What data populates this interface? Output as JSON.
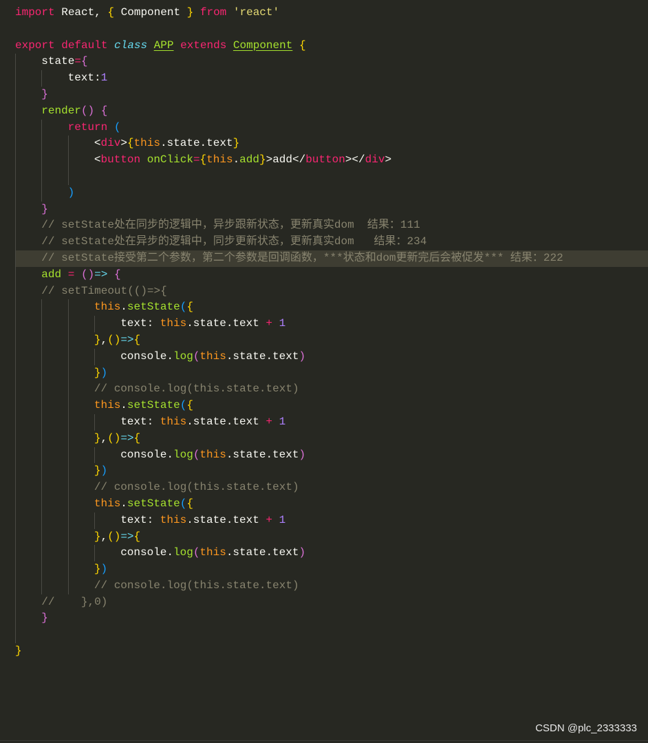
{
  "editor": {
    "highlighted_line": 15,
    "lines": [
      {
        "indent": 0,
        "tokens": [
          [
            "import",
            "kw"
          ],
          [
            " React, ",
            "tx"
          ],
          [
            "{",
            "b1"
          ],
          [
            " Component ",
            "tx"
          ],
          [
            "}",
            "b1"
          ],
          [
            " ",
            "tx"
          ],
          [
            "from",
            "kw"
          ],
          [
            " ",
            "tx"
          ],
          [
            "'react'",
            "str"
          ]
        ]
      },
      {
        "indent": 0,
        "tokens": []
      },
      {
        "indent": 0,
        "tokens": [
          [
            "export",
            "kw"
          ],
          [
            " ",
            "tx"
          ],
          [
            "default",
            "kw"
          ],
          [
            " ",
            "tx"
          ],
          [
            "class",
            "cls"
          ],
          [
            " ",
            "tx"
          ],
          [
            "APP",
            "ty"
          ],
          [
            " ",
            "tx"
          ],
          [
            "extends",
            "kw"
          ],
          [
            " ",
            "tx"
          ],
          [
            "Component",
            "ty"
          ],
          [
            " ",
            "tx"
          ],
          [
            "{",
            "b1"
          ]
        ]
      },
      {
        "indent": 1,
        "tokens": [
          [
            "state",
            "tx"
          ],
          [
            "=",
            "op"
          ],
          [
            "{",
            "b2"
          ]
        ]
      },
      {
        "indent": 2,
        "tokens": [
          [
            "text:",
            "tx"
          ],
          [
            "1",
            "num"
          ]
        ]
      },
      {
        "indent": 1,
        "tokens": [
          [
            "}",
            "b2"
          ]
        ]
      },
      {
        "indent": 1,
        "tokens": [
          [
            "render",
            "fn"
          ],
          [
            "(",
            "b2"
          ],
          [
            ")",
            "b2"
          ],
          [
            " ",
            "tx"
          ],
          [
            "{",
            "b2"
          ]
        ]
      },
      {
        "indent": 2,
        "tokens": [
          [
            "return",
            "kw"
          ],
          [
            " ",
            "tx"
          ],
          [
            "(",
            "b3"
          ]
        ]
      },
      {
        "indent": 3,
        "tokens": [
          [
            "<",
            "tx"
          ],
          [
            "div",
            "kw"
          ],
          [
            ">",
            "tx"
          ],
          [
            "{",
            "b1"
          ],
          [
            "this",
            "th"
          ],
          [
            ".state.text",
            "tx"
          ],
          [
            "}",
            "b1"
          ]
        ]
      },
      {
        "indent": 3,
        "tokens": [
          [
            "<",
            "tx"
          ],
          [
            "button",
            "kw"
          ],
          [
            " ",
            "tx"
          ],
          [
            "onClick",
            "fn"
          ],
          [
            "=",
            "op"
          ],
          [
            "{",
            "b1"
          ],
          [
            "this",
            "th"
          ],
          [
            ".",
            "tx"
          ],
          [
            "add",
            "fn"
          ],
          [
            "}",
            "b1"
          ],
          [
            ">add</",
            "tx"
          ],
          [
            "button",
            "kw"
          ],
          [
            "></",
            "tx"
          ],
          [
            "div",
            "kw"
          ],
          [
            ">",
            "tx"
          ]
        ]
      },
      {
        "indent": 3,
        "tokens": []
      },
      {
        "indent": 2,
        "tokens": [
          [
            ")",
            "b3"
          ]
        ]
      },
      {
        "indent": 1,
        "tokens": [
          [
            "}",
            "b2"
          ]
        ]
      },
      {
        "indent": 1,
        "tokens": [
          [
            "// setState处在同步的逻辑中，异步跟新状态，更新真实dom  结果：111",
            "cm"
          ]
        ]
      },
      {
        "indent": 1,
        "tokens": [
          [
            "// setState处在异步的逻辑中，同步更新状态，更新真实dom   结果：234",
            "cm"
          ]
        ]
      },
      {
        "indent": 1,
        "tokens": [
          [
            "// setState接受第二个参数，第二个参数是回调函数，***状态和dom更新完后会被促发*** 结果：222",
            "cm"
          ]
        ]
      },
      {
        "indent": 1,
        "tokens": [
          [
            "add",
            "fn"
          ],
          [
            " ",
            "tx"
          ],
          [
            "=",
            "op"
          ],
          [
            " ",
            "tx"
          ],
          [
            "(",
            "b2"
          ],
          [
            ")",
            "b2"
          ],
          [
            "=>",
            "ar"
          ],
          [
            " ",
            "tx"
          ],
          [
            "{",
            "b2"
          ]
        ]
      },
      {
        "indent": 1,
        "tokens": [
          [
            "// setTimeout(()=>{",
            "cm"
          ]
        ]
      },
      {
        "indent": 3,
        "tokens": [
          [
            "this",
            "th"
          ],
          [
            ".",
            "tx"
          ],
          [
            "setState",
            "fn"
          ],
          [
            "(",
            "b3"
          ],
          [
            "{",
            "b1"
          ]
        ]
      },
      {
        "indent": 4,
        "tokens": [
          [
            "text: ",
            "tx"
          ],
          [
            "this",
            "th"
          ],
          [
            ".state.text ",
            "tx"
          ],
          [
            "+",
            "op"
          ],
          [
            " ",
            "tx"
          ],
          [
            "1",
            "num"
          ]
        ]
      },
      {
        "indent": 3,
        "tokens": [
          [
            "}",
            "b1"
          ],
          [
            ",",
            "tx"
          ],
          [
            "(",
            "b1"
          ],
          [
            ")",
            "b1"
          ],
          [
            "=>",
            "ar"
          ],
          [
            "{",
            "b1"
          ]
        ]
      },
      {
        "indent": 4,
        "tokens": [
          [
            "console.",
            "tx"
          ],
          [
            "log",
            "fn"
          ],
          [
            "(",
            "b2"
          ],
          [
            "this",
            "th"
          ],
          [
            ".state.text",
            "tx"
          ],
          [
            ")",
            "b2"
          ]
        ]
      },
      {
        "indent": 3,
        "tokens": [
          [
            "}",
            "b1"
          ],
          [
            ")",
            "b3"
          ]
        ]
      },
      {
        "indent": 3,
        "tokens": [
          [
            "// console.log(this.state.text)",
            "cm"
          ]
        ]
      },
      {
        "indent": 3,
        "tokens": [
          [
            "this",
            "th"
          ],
          [
            ".",
            "tx"
          ],
          [
            "setState",
            "fn"
          ],
          [
            "(",
            "b3"
          ],
          [
            "{",
            "b1"
          ]
        ]
      },
      {
        "indent": 4,
        "tokens": [
          [
            "text: ",
            "tx"
          ],
          [
            "this",
            "th"
          ],
          [
            ".state.text ",
            "tx"
          ],
          [
            "+",
            "op"
          ],
          [
            " ",
            "tx"
          ],
          [
            "1",
            "num"
          ]
        ]
      },
      {
        "indent": 3,
        "tokens": [
          [
            "}",
            "b1"
          ],
          [
            ",",
            "tx"
          ],
          [
            "(",
            "b1"
          ],
          [
            ")",
            "b1"
          ],
          [
            "=>",
            "ar"
          ],
          [
            "{",
            "b1"
          ]
        ]
      },
      {
        "indent": 4,
        "tokens": [
          [
            "console.",
            "tx"
          ],
          [
            "log",
            "fn"
          ],
          [
            "(",
            "b2"
          ],
          [
            "this",
            "th"
          ],
          [
            ".state.text",
            "tx"
          ],
          [
            ")",
            "b2"
          ]
        ]
      },
      {
        "indent": 3,
        "tokens": [
          [
            "}",
            "b1"
          ],
          [
            ")",
            "b3"
          ]
        ]
      },
      {
        "indent": 3,
        "tokens": [
          [
            "// console.log(this.state.text)",
            "cm"
          ]
        ]
      },
      {
        "indent": 3,
        "tokens": [
          [
            "this",
            "th"
          ],
          [
            ".",
            "tx"
          ],
          [
            "setState",
            "fn"
          ],
          [
            "(",
            "b3"
          ],
          [
            "{",
            "b1"
          ]
        ]
      },
      {
        "indent": 4,
        "tokens": [
          [
            "text: ",
            "tx"
          ],
          [
            "this",
            "th"
          ],
          [
            ".state.text ",
            "tx"
          ],
          [
            "+",
            "op"
          ],
          [
            " ",
            "tx"
          ],
          [
            "1",
            "num"
          ]
        ]
      },
      {
        "indent": 3,
        "tokens": [
          [
            "}",
            "b1"
          ],
          [
            ",",
            "tx"
          ],
          [
            "(",
            "b1"
          ],
          [
            ")",
            "b1"
          ],
          [
            "=>",
            "ar"
          ],
          [
            "{",
            "b1"
          ]
        ]
      },
      {
        "indent": 4,
        "tokens": [
          [
            "console.",
            "tx"
          ],
          [
            "log",
            "fn"
          ],
          [
            "(",
            "b2"
          ],
          [
            "this",
            "th"
          ],
          [
            ".state.text",
            "tx"
          ],
          [
            ")",
            "b2"
          ]
        ]
      },
      {
        "indent": 3,
        "tokens": [
          [
            "}",
            "b1"
          ],
          [
            ")",
            "b3"
          ]
        ]
      },
      {
        "indent": 3,
        "tokens": [
          [
            "// console.log(this.state.text)",
            "cm"
          ]
        ]
      },
      {
        "indent": 1,
        "tokens": [
          [
            "//    },0)",
            "cm"
          ]
        ]
      },
      {
        "indent": 1,
        "tokens": [
          [
            "}",
            "b2"
          ]
        ]
      },
      {
        "indent": 1,
        "tokens": []
      },
      {
        "indent": 0,
        "tokens": [
          [
            "}",
            "b1"
          ]
        ]
      }
    ]
  },
  "watermark": "CSDN @plc_2333333",
  "colors": {
    "background": "#272822",
    "line_highlight": "#3e3d32",
    "keyword": "#f92672",
    "function": "#a6e22e",
    "string": "#e6db74",
    "number": "#ae81ff",
    "comment": "#88846f",
    "this": "#fd971f"
  }
}
